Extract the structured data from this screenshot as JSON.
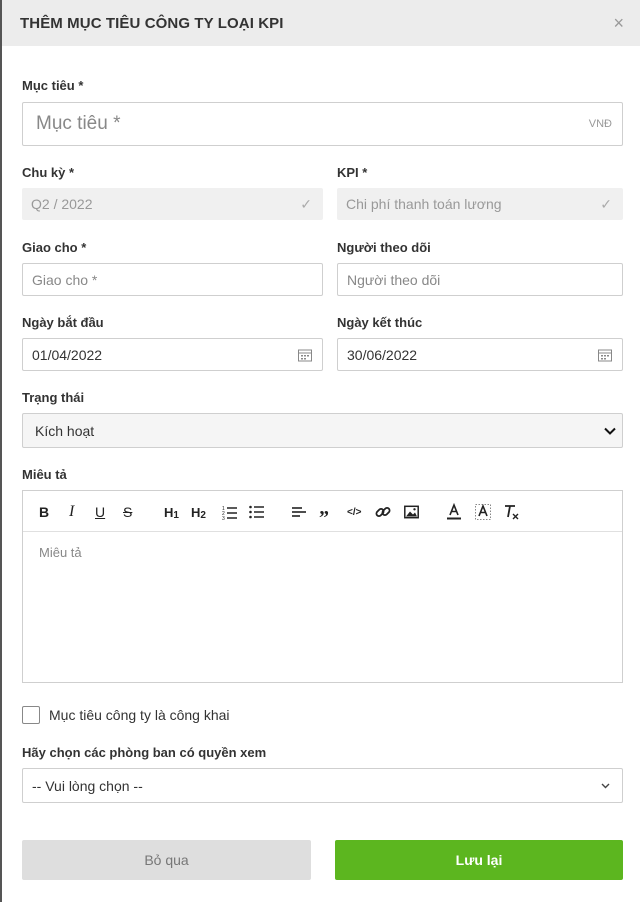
{
  "dialog": {
    "title": "THÊM MỤC TIÊU CÔNG TY LOẠI KPI",
    "close_glyph": "×"
  },
  "form": {
    "target": {
      "label": "Mục tiêu *",
      "placeholder": "Mục tiêu *",
      "suffix": "VNĐ"
    },
    "cycle": {
      "label": "Chu kỳ *",
      "value": "Q2 / 2022"
    },
    "kpi": {
      "label": "KPI *",
      "value": "Chi phí thanh toán lương"
    },
    "assignee": {
      "label": "Giao cho *",
      "placeholder": "Giao cho *"
    },
    "follower": {
      "label": "Người theo dõi",
      "placeholder": "Người theo dõi"
    },
    "start_date": {
      "label": "Ngày bắt đầu",
      "value": "01/04/2022"
    },
    "end_date": {
      "label": "Ngày kết thúc",
      "value": "30/06/2022"
    },
    "status": {
      "label": "Trạng thái",
      "value": "Kích hoạt"
    },
    "description": {
      "label": "Miêu tả",
      "placeholder": "Miêu tả"
    },
    "public_checkbox": {
      "label": "Mục tiêu công ty là công khai",
      "checked": false
    },
    "departments": {
      "label": "Hãy chọn các phòng ban có quyền xem",
      "value": "-- Vui lòng chọn --"
    }
  },
  "toolbar": {
    "bold": "B",
    "italic": "I",
    "underline": "U",
    "strike": "S",
    "h1": "H1",
    "h2": "H2"
  },
  "buttons": {
    "cancel": "Bỏ qua",
    "save": "Lưu lại"
  },
  "colors": {
    "save": "#5cb61f",
    "cancel": "#dedede",
    "header": "#ececec"
  }
}
